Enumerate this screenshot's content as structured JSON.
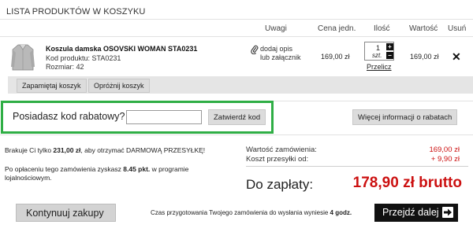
{
  "section": {
    "title": "LISTA PRODUKTÓW W KOSZYKU"
  },
  "columns": {
    "notes": "Uwagi",
    "unit_price": "Cena jedn.",
    "quantity": "Ilość",
    "value": "Wartość",
    "remove": "Usuń"
  },
  "product": {
    "name": "Koszula damska OSOVSKI WOMAN STA0231",
    "code_line": "Kod produktu: STA0231",
    "size_line": "Rozmiar: 42",
    "note_link_1": "dodaj opis",
    "note_link_2": "lub załącznik",
    "unit_price": "169,00 zł",
    "quantity": "1",
    "quantity_unit": "szt.",
    "recalc": "Przelicz",
    "total": "169,00 zł",
    "remove_glyph": "✕",
    "plus_glyph": "+",
    "minus_glyph": "−"
  },
  "cart_actions": {
    "save": "Zapamiętaj koszyk",
    "clear": "Opróżnij koszyk"
  },
  "coupon": {
    "label": "Posiadasz kod rabatowy?",
    "input_value": "",
    "apply": "Zatwierdź kod",
    "more_info": "Więcej informacji o rabatach"
  },
  "info": {
    "free_ship_pre": "Brakuje Ci tylko ",
    "free_ship_amount": "231,00 zł",
    "free_ship_post": ", aby otrzymać DARMOWĄ PRZESYŁKĘ!",
    "points_pre": "Po opłaceniu tego zamówienia zyskasz ",
    "points_value": "8.45 pkt.",
    "points_post": " w programie",
    "points_line2": "lojalnościowym."
  },
  "summary": {
    "order_value_label": "Wartość zamówienia:",
    "order_value": "169,00 zł",
    "shipping_label": "Koszt przesyłki od:",
    "shipping_value": "+ 9,90 zł",
    "total_label": "Do zapłaty:",
    "total_value": "178,90 zł brutto"
  },
  "footer": {
    "continue": "Kontynuuj zakupy",
    "prep_pre": "Czas przygotowania Twojego zamówienia do wysłania wyniesie ",
    "prep_value": "4 godz.",
    "next": "Przejdź dalej"
  },
  "colors": {
    "accent_red": "#cc1111",
    "highlight_green": "#2fae45"
  }
}
